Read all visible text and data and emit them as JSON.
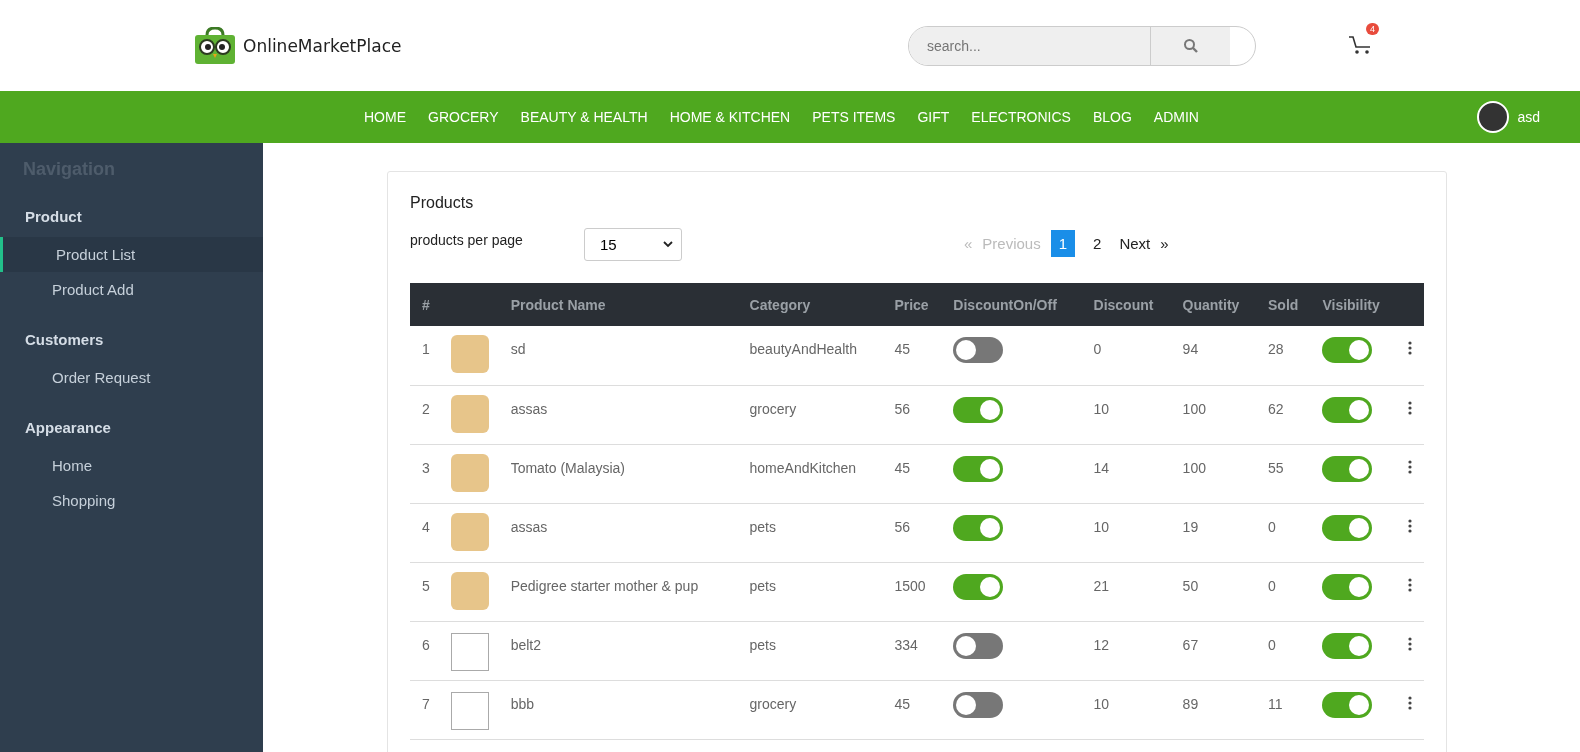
{
  "brand": {
    "name": "OnlineMarketPlace"
  },
  "search": {
    "placeholder": "search..."
  },
  "cart": {
    "badge": "4"
  },
  "nav": {
    "items": [
      "HOME",
      "GROCERY",
      "BEAUTY & HEALTH",
      "HOME & KITCHEN",
      "PETS ITEMS",
      "GIFT",
      "ELECTRONICS",
      "BLOG",
      "ADMIN"
    ],
    "user": "asd"
  },
  "sidebar": {
    "title": "Navigation",
    "sections": [
      {
        "label": "Product",
        "items": [
          {
            "label": "Product List",
            "selected": true
          },
          {
            "label": "Product Add",
            "selected": false
          }
        ]
      },
      {
        "label": "Customers",
        "items": [
          {
            "label": "Order Request",
            "selected": false
          }
        ]
      },
      {
        "label": "Appearance",
        "items": [
          {
            "label": "Home",
            "selected": false
          },
          {
            "label": "Shopping",
            "selected": false
          }
        ]
      }
    ]
  },
  "card": {
    "title": "Products",
    "per_page_label": "products per page",
    "per_page": "15",
    "pagination": {
      "first": "«",
      "previous": "Previous",
      "previous_disabled": true,
      "pages": [
        {
          "label": "1",
          "selected": true
        },
        {
          "label": "2",
          "selected": false
        }
      ],
      "next": "Next",
      "last": "»"
    }
  },
  "table": {
    "columns": [
      "#",
      "Product Name",
      "Category",
      "Price",
      "DiscountOn/Off",
      "Discount",
      "Quantity",
      "Sold",
      "Visibility"
    ],
    "rows": [
      {
        "num": "1",
        "kind": "photo",
        "name": "sd",
        "category": "beautyAndHealth",
        "price": "45",
        "discount_on": false,
        "discount": "0",
        "quantity": "94",
        "sold": "28",
        "visible": true
      },
      {
        "num": "2",
        "kind": "photo",
        "name": "assas",
        "category": "grocery",
        "price": "56",
        "discount_on": true,
        "discount": "10",
        "quantity": "100",
        "sold": "62",
        "visible": true
      },
      {
        "num": "3",
        "kind": "photo",
        "name": "Tomato (Malaysia)",
        "category": "homeAndKitchen",
        "price": "45",
        "discount_on": true,
        "discount": "14",
        "quantity": "100",
        "sold": "55",
        "visible": true
      },
      {
        "num": "4",
        "kind": "photo",
        "name": "assas",
        "category": "pets",
        "price": "56",
        "discount_on": true,
        "discount": "10",
        "quantity": "19",
        "sold": "0",
        "visible": true
      },
      {
        "num": "5",
        "kind": "photo",
        "name": "Pedigree starter mother & pup",
        "category": "pets",
        "price": "1500",
        "discount_on": true,
        "discount": "21",
        "quantity": "50",
        "sold": "0",
        "visible": true
      },
      {
        "num": "6",
        "kind": "broken",
        "name": "belt2",
        "category": "pets",
        "price": "334",
        "discount_on": false,
        "discount": "12",
        "quantity": "67",
        "sold": "0",
        "visible": true
      },
      {
        "num": "7",
        "kind": "broken",
        "name": "bbb",
        "category": "grocery",
        "price": "45",
        "discount_on": false,
        "discount": "10",
        "quantity": "89",
        "sold": "11",
        "visible": true
      }
    ]
  }
}
